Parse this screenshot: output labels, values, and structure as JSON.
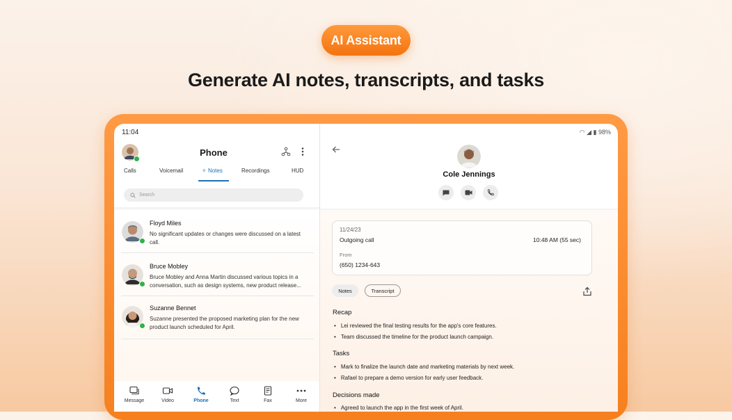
{
  "badge": "AI Assistant",
  "headline": "Generate AI notes, transcripts, and tasks",
  "left": {
    "time": "11:04",
    "title": "Phone",
    "tabs": [
      "Calls",
      "Voicemail",
      "Notes",
      "Recordings",
      "HUD"
    ],
    "active_tab": "Notes",
    "search_placeholder": "Search",
    "items": [
      {
        "name": "Floyd Miles",
        "preview": "No significant updates or changes were discussed on a latest call."
      },
      {
        "name": "Bruce Mobley",
        "preview": "Bruce Mobley and Anna Martin discussed various topics in a conversation, such as design systems, new product release..."
      },
      {
        "name": "Suzanne Bennet",
        "preview": "Suzanne presented the proposed marketing plan for the new product launch scheduled for April."
      }
    ],
    "nav": [
      "Message",
      "Video",
      "Phone",
      "Text",
      "Fax",
      "More"
    ],
    "active_nav": "Phone"
  },
  "right": {
    "battery": "98%",
    "contact": "Cole Jennings",
    "call": {
      "date": "11/24/23",
      "type": "Outgoing call",
      "time": "10:48 AM (55 sec)",
      "from_label": "From",
      "number": "(650) 1234-643"
    },
    "chips": [
      "Notes",
      "Transcript"
    ],
    "sections": {
      "recap_title": "Recap",
      "recap": [
        "Lei reviewed the final testing results for the app's core features.",
        "Team discussed the timeline for the product launch campaign."
      ],
      "tasks_title": "Tasks",
      "tasks": [
        "Mark to finalize the launch date and marketing materials by next week.",
        "Rafael to prepare a demo version for early user feedback."
      ],
      "decisions_title": "Decisions made",
      "decisions": [
        "Agreed to launch the app in the first week of April."
      ]
    }
  },
  "colors": {
    "accent": "#1f6fb3",
    "orange": "#f6801f",
    "online": "#2fb34a"
  }
}
